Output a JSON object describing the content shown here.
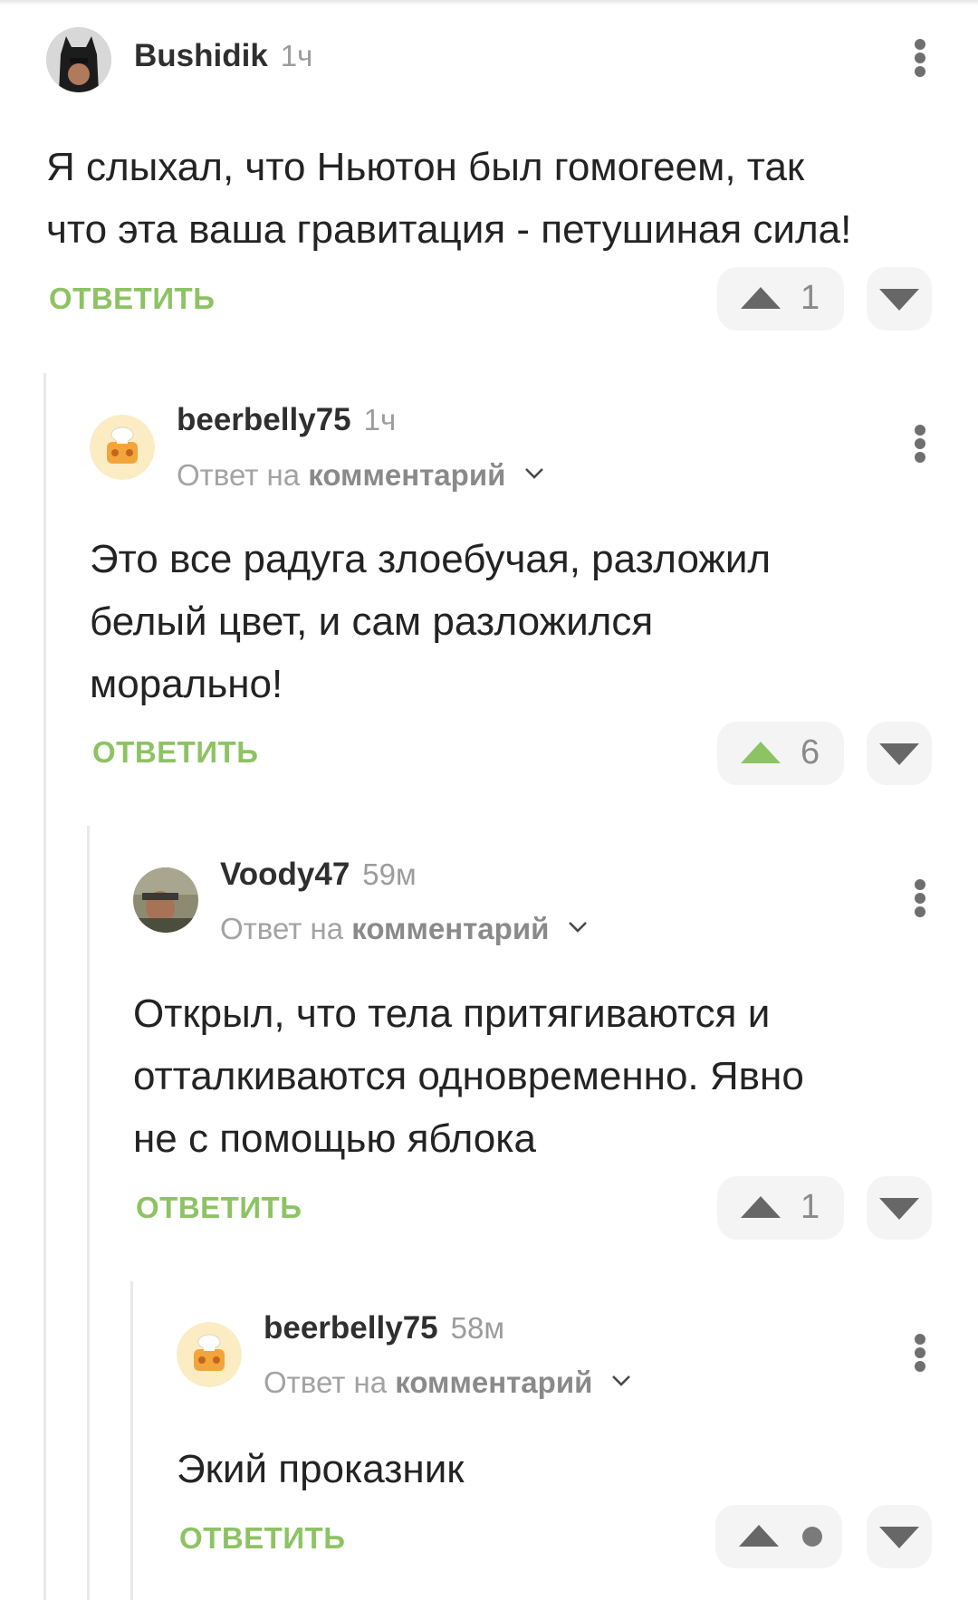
{
  "comments": [
    {
      "author": "Bushidik",
      "time": "1ч",
      "reply_to": null,
      "text_lines": [
        "Я слыхал, что Ньютон был гомогеем, так",
        "что эта ваша гравитация - петушиная сила!"
      ],
      "reply_label": "ОТВЕТИТЬ",
      "rating": "1",
      "upvoted": false
    },
    {
      "author": "beerbelly75",
      "time": "1ч",
      "reply_to": {
        "prefix": "Ответ на",
        "target": "комментарий"
      },
      "text_lines": [
        "Это все радуга злоебучая, разложил",
        "белый цвет, и сам разложился",
        "морально!"
      ],
      "reply_label": "ОТВЕТИТЬ",
      "rating": "6",
      "upvoted": true
    },
    {
      "author": "Voody47",
      "time": "59м",
      "reply_to": {
        "prefix": "Ответ на",
        "target": "комментарий"
      },
      "text_lines": [
        "Открыл, что тела притягиваются и",
        "отталкиваются одновременно. Явно",
        "не с помощью яблока"
      ],
      "reply_label": "ОТВЕТИТЬ",
      "rating": "1",
      "upvoted": false
    },
    {
      "author": "beerbelly75",
      "time": "58м",
      "reply_to": {
        "prefix": "Ответ на",
        "target": "комментарий"
      },
      "text_lines": [
        "Экий проказник"
      ],
      "reply_label": "ОТВЕТИТЬ",
      "rating": null,
      "upvoted": false
    }
  ],
  "icons": {
    "upvote": "triangle-up-icon",
    "downvote": "triangle-down-icon",
    "menu": "kebab-menu-icon",
    "expand": "chevron-down-icon",
    "rating_hidden": "dot-icon"
  },
  "colors": {
    "accent": "#8dc363",
    "vote_bg": "#f4f4f4",
    "thread_line": "#e9e9e9"
  }
}
